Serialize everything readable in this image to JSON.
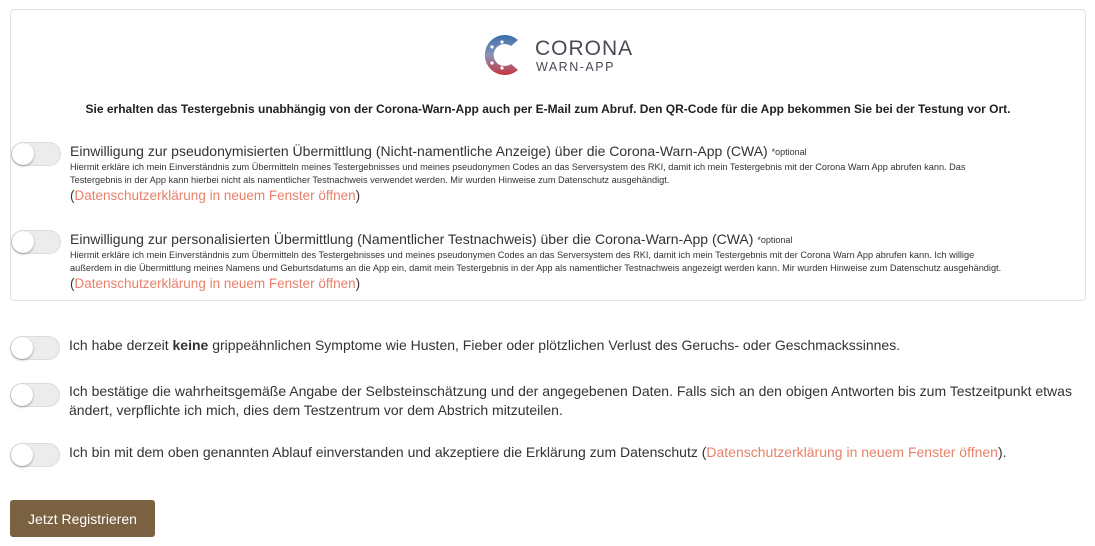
{
  "logo": {
    "word1": "CORONA",
    "word2": "WARN-APP",
    "icon": "corona-virus-icon"
  },
  "info_text": "Sie erhalten das Testergebnis unabhängig von der Corona-Warn-App auch per E-Mail zum Abruf. Den QR-Code für die App bekommen Sie bei der Testung vor Ort.",
  "consents": [
    {
      "title": "Einwilligung zur pseudonymisierten Übermittlung (Nicht-namentliche Anzeige) über die Corona-Warn-App (CWA)",
      "optional": "*optional",
      "description_line1": "Hiermit erkläre ich mein Einverständnis zum Übermitteln meines Testergebnisses und meines pseudonymen Codes an das Serversystem des RKI, damit ich mein Testergebnis mit der Corona Warn App abrufen kann. Das",
      "description_line2": "Testergebnis in der App kann hierbei nicht als namentlicher Testnachweis verwendet werden. Mir wurden Hinweise zum Datenschutz ausgehändigt.",
      "link": "Datenschutzerklärung in neuem Fenster öffnen",
      "toggle_on": false
    },
    {
      "title": "Einwilligung zur personalisierten Übermittlung (Namentlicher Testnachweis) über die Corona-Warn-App (CWA)",
      "optional": "*optional",
      "description_line1": "Hiermit erkläre ich mein Einverständnis zum Übermitteln des Testergebnisses und meines pseudonymen Codes an das Serversystem des RKI, damit ich mein Testergebnis mit der Corona Warn App abrufen kann. Ich willige",
      "description_line2": "außerdem in die Übermittlung meines Namens und Geburtsdatums an die App ein, damit mein Testergebnis in der App als namentlicher Testnachweis angezeigt werden kann. Mir wurden Hinweise zum Datenschutz ausgehändigt.",
      "link": "Datenschutzerklärung in neuem Fenster öffnen",
      "toggle_on": false
    }
  ],
  "statements": {
    "symptoms": {
      "before": "Ich habe derzeit ",
      "bold": "keine",
      "after": " grippeähnlichen Symptome wie Husten, Fieber oder plötzlichen Verlust des Geruchs- oder Geschmackssinnes.",
      "toggle_on": false
    },
    "truthful": {
      "line1": "Ich bestätige die wahrheitsgemäße Angabe der Selbsteinschätzung und der angegebenen Daten. Falls sich an den obigen Antworten bis zum Testzeitpunkt etwas",
      "line2": "ändert, verpflichte ich mich, dies dem Testzentrum vor dem Abstrich mitzuteilen.",
      "toggle_on": false
    },
    "agree": {
      "before": "Ich bin mit dem oben genannten Ablauf einverstanden und akzeptiere die Erklärung zum Datenschutz (",
      "link": "Datenschutzerklärung in neuem Fenster öffnen",
      "after": ").",
      "toggle_on": false
    }
  },
  "register_button": "Jetzt Registrieren",
  "colors": {
    "link": "#e8806a",
    "button": "#7a6141",
    "logo_red": "#c9343a",
    "logo_blue": "#3b6fa8"
  }
}
